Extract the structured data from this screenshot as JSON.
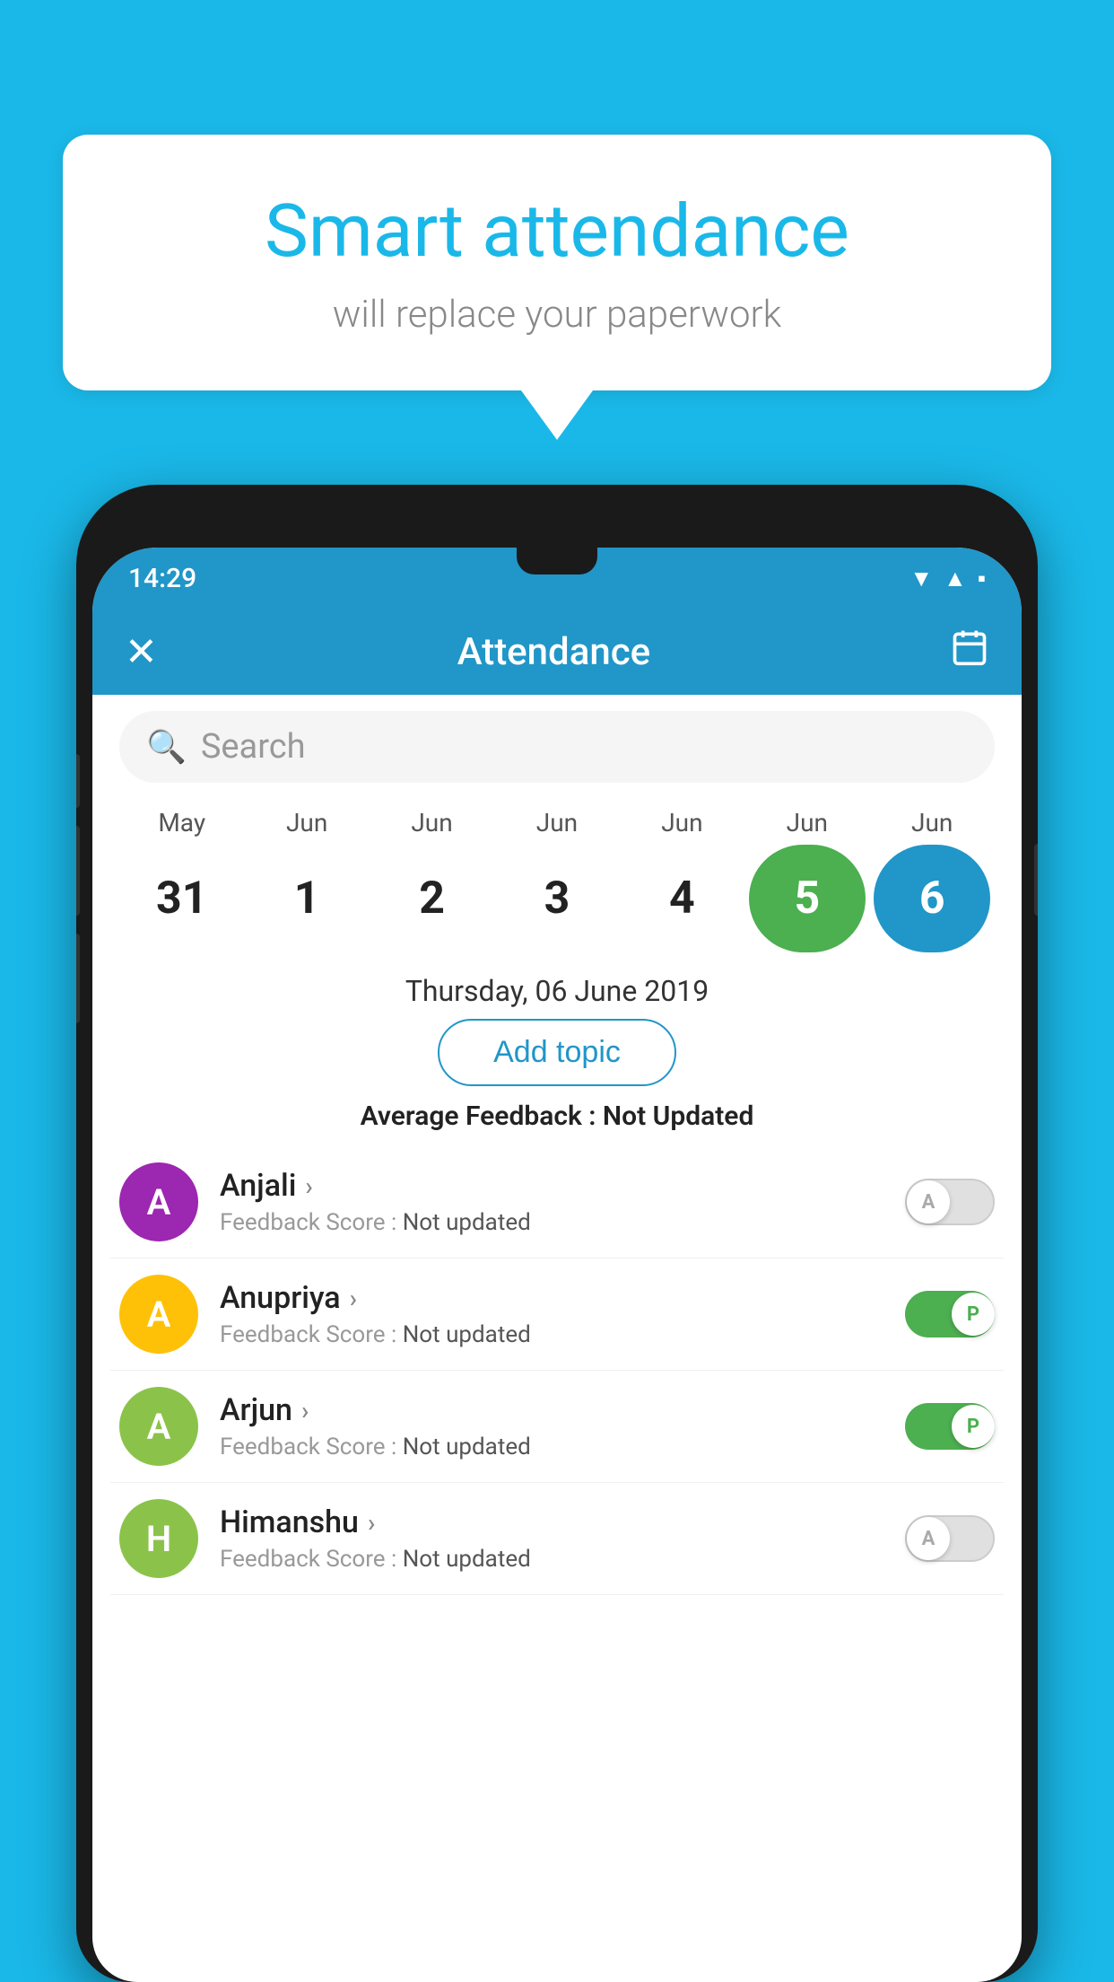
{
  "background_color": "#1ab8e8",
  "speech_bubble": {
    "title": "Smart attendance",
    "subtitle": "will replace your paperwork"
  },
  "status_bar": {
    "time": "14:29",
    "icons": [
      "wifi",
      "signal",
      "battery"
    ]
  },
  "app_bar": {
    "close_icon": "✕",
    "title": "Attendance",
    "calendar_icon": "📅"
  },
  "search": {
    "placeholder": "Search"
  },
  "calendar": {
    "months": [
      "May",
      "Jun",
      "Jun",
      "Jun",
      "Jun",
      "Jun",
      "Jun"
    ],
    "days": [
      "31",
      "1",
      "2",
      "3",
      "4",
      "5",
      "6"
    ],
    "today_index": 5,
    "selected_index": 6
  },
  "selected_date": "Thursday, 06 June 2019",
  "add_topic_label": "Add topic",
  "average_feedback": {
    "label": "Average Feedback : ",
    "value": "Not Updated"
  },
  "students": [
    {
      "name": "Anjali",
      "avatar_letter": "A",
      "avatar_color": "#9C27B0",
      "feedback_label": "Feedback Score : ",
      "feedback_value": "Not updated",
      "toggle_state": "off",
      "toggle_letter": "A"
    },
    {
      "name": "Anupriya",
      "avatar_letter": "A",
      "avatar_color": "#FFC107",
      "feedback_label": "Feedback Score : ",
      "feedback_value": "Not updated",
      "toggle_state": "on",
      "toggle_letter": "P"
    },
    {
      "name": "Arjun",
      "avatar_letter": "A",
      "avatar_color": "#8BC34A",
      "feedback_label": "Feedback Score : ",
      "feedback_value": "Not updated",
      "toggle_state": "on",
      "toggle_letter": "P"
    },
    {
      "name": "Himanshu",
      "avatar_letter": "H",
      "avatar_color": "#8BC34A",
      "feedback_label": "Feedback Score : ",
      "feedback_value": "Not updated",
      "toggle_state": "off",
      "toggle_letter": "A"
    }
  ]
}
